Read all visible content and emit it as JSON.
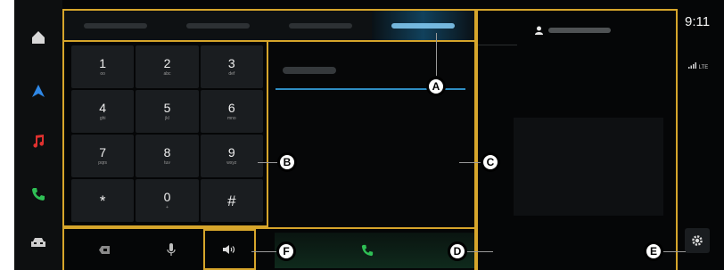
{
  "status": {
    "time": "9:11",
    "network": "LTE"
  },
  "nav": {
    "items": [
      "home-icon",
      "navigation-icon",
      "music-icon",
      "phone-icon",
      "car-icon"
    ]
  },
  "keypad": {
    "keys": [
      {
        "digit": "1",
        "letters": "oo"
      },
      {
        "digit": "2",
        "letters": "abc"
      },
      {
        "digit": "3",
        "letters": "def"
      },
      {
        "digit": "4",
        "letters": "ghi"
      },
      {
        "digit": "5",
        "letters": "jkl"
      },
      {
        "digit": "6",
        "letters": "mno"
      },
      {
        "digit": "7",
        "letters": "pqrs"
      },
      {
        "digit": "8",
        "letters": "tuv"
      },
      {
        "digit": "9",
        "letters": "wxyz"
      },
      {
        "digit": "*",
        "letters": ""
      },
      {
        "digit": "0",
        "letters": "+"
      },
      {
        "digit": "#",
        "letters": ""
      }
    ]
  },
  "callouts": {
    "a": "A",
    "b": "B",
    "c": "C",
    "d": "D",
    "e": "E",
    "f": "F"
  },
  "colors": {
    "accent": "#d6a52b",
    "call": "#2fbf55",
    "active_tab": "#2f8dc2"
  }
}
